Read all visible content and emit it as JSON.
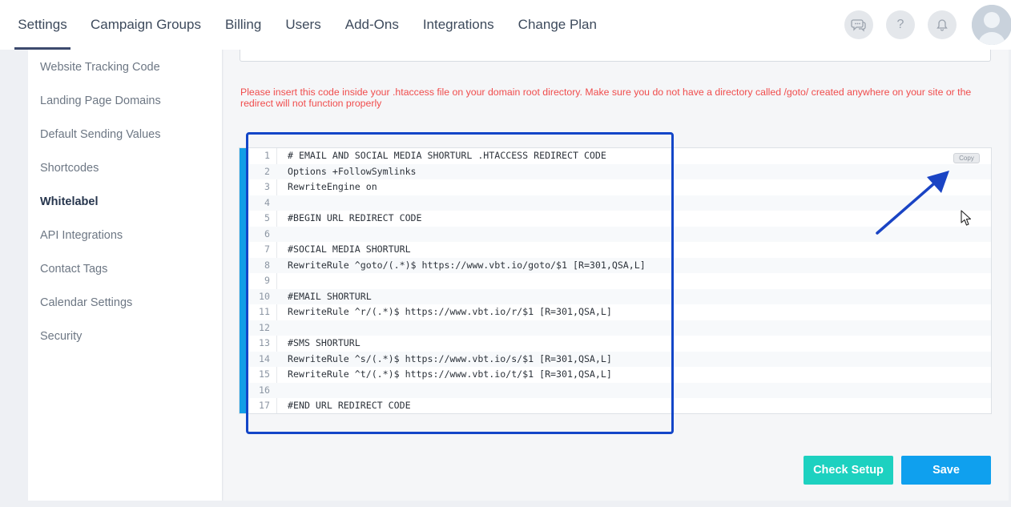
{
  "nav": {
    "items": [
      "Settings",
      "Campaign Groups",
      "Billing",
      "Users",
      "Add-Ons",
      "Integrations",
      "Change Plan"
    ],
    "active": "Settings",
    "help_label": "?"
  },
  "sidebar": {
    "items": [
      {
        "label": "Website Tracking Code"
      },
      {
        "label": "Landing Page Domains"
      },
      {
        "label": "Default Sending Values"
      },
      {
        "label": "Shortcodes"
      },
      {
        "label": "Whitelabel",
        "active": true
      },
      {
        "label": "API Integrations"
      },
      {
        "label": "Contact Tags"
      },
      {
        "label": "Calendar Settings"
      },
      {
        "label": "Security"
      }
    ]
  },
  "main": {
    "warning": "Please insert this code inside your .htaccess file on your domain root directory. Make sure you do not have a directory called /goto/ created anywhere on your site or the redirect will not function properly",
    "copy_label": "Copy",
    "code_lines": [
      "# EMAIL AND SOCIAL MEDIA SHORTURL .HTACCESS REDIRECT CODE",
      "Options +FollowSymlinks",
      "RewriteEngine on",
      "",
      "#BEGIN URL REDIRECT CODE",
      "",
      "#SOCIAL MEDIA SHORTURL",
      "RewriteRule ^goto/(.*)$ https://www.vbt.io/goto/$1 [R=301,QSA,L]",
      "",
      "#EMAIL SHORTURL",
      "RewriteRule ^r/(.*)$ https://www.vbt.io/r/$1 [R=301,QSA,L]",
      "",
      "#SMS SHORTURL",
      "RewriteRule ^s/(.*)$ https://www.vbt.io/s/$1 [R=301,QSA,L]",
      "RewriteRule ^t/(.*)$ https://www.vbt.io/t/$1 [R=301,QSA,L]",
      "",
      "#END URL REDIRECT CODE"
    ],
    "check_setup_label": "Check Setup",
    "save_label": "Save"
  },
  "colors": {
    "accent_blue": "#129ee6",
    "teal": "#1dd1c0",
    "warning_red": "#f04c4c",
    "highlight": "#1346c8"
  },
  "icons": [
    "chat-icon",
    "help-icon",
    "bell-icon",
    "avatar"
  ]
}
